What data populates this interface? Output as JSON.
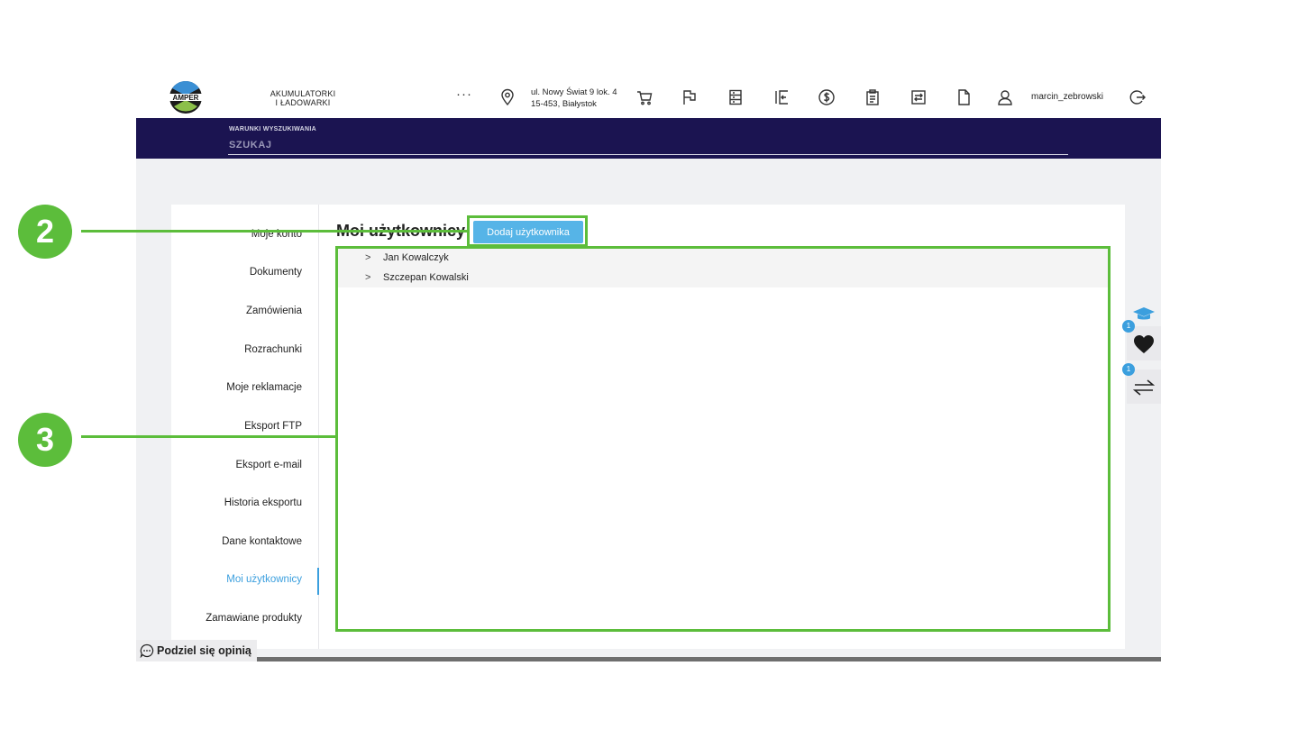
{
  "header": {
    "category_line1": "AKUMULATORKI",
    "category_line2": "I ŁADOWARKI",
    "more": "···",
    "address_line1": "ul. Nowy Świat 9 lok. 4",
    "address_line2": "15-453, Białystok",
    "username": "marcin_zebrowski",
    "icons": [
      "location-icon",
      "cart-icon",
      "flag-icon",
      "list-icon",
      "return-icon",
      "dollar-icon",
      "clipboard-icon",
      "exchange-icon",
      "document-icon",
      "user-icon",
      "logout-icon"
    ]
  },
  "search": {
    "caption": "WARUNKI WYSZUKIWANIA",
    "placeholder": "SZUKAJ"
  },
  "sidebar": {
    "items": [
      {
        "label": "Moje konto"
      },
      {
        "label": "Dokumenty"
      },
      {
        "label": "Zamówienia"
      },
      {
        "label": "Rozrachunki"
      },
      {
        "label": "Moje reklamacje"
      },
      {
        "label": "Eksport FTP"
      },
      {
        "label": "Eksport e-mail"
      },
      {
        "label": "Historia eksportu"
      },
      {
        "label": "Dane kontaktowe"
      },
      {
        "label": "Moi użytkownicy"
      },
      {
        "label": "Zamawiane produkty"
      }
    ],
    "active": "Moi użytkownicy"
  },
  "main": {
    "title": "Moi użytkownicy",
    "add_button": "Dodaj użytkownika",
    "users": [
      {
        "name": "Jan Kowalczyk"
      },
      {
        "name": "Szczepan Kowalski"
      }
    ]
  },
  "widgets": {
    "favorites_count": "1",
    "compare_count": "1"
  },
  "feedback": {
    "label": "Podziel się opinią"
  },
  "callouts": {
    "add_button_marker": "2",
    "user_list_marker": "3"
  },
  "colors": {
    "brand_navy": "#1b1451",
    "accent_blue": "#3b9fde",
    "button_blue": "#56b4e7",
    "callout_green": "#5cbd3b"
  }
}
